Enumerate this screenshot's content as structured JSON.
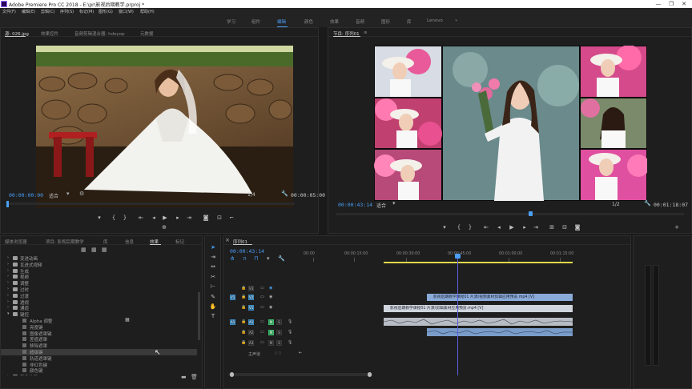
{
  "window": {
    "title": "Adobe Premiere Pro CC 2018 - E:\\pr\\影视后期教学.prproj *",
    "controls": [
      "—",
      "❐",
      "✕"
    ]
  },
  "menu": [
    "文件(F)",
    "编辑(E)",
    "剪辑(C)",
    "序列(S)",
    "标记(M)",
    "图形(G)",
    "窗口(W)",
    "帮助(H)"
  ],
  "workspaces": {
    "items": [
      "学习",
      "组件",
      "编辑",
      "颜色",
      "效果",
      "音频",
      "图形",
      "库",
      "Lenovo"
    ],
    "active_index": 2,
    "more": "»"
  },
  "source_monitor": {
    "tabs": [
      "源: 026.jpg",
      "效果控件",
      "音频剪辑混合器: hdeyop",
      "元数据"
    ],
    "active_index": 0,
    "timecode_in": "00:00:00:00",
    "fit": "适合",
    "fraction": "1/4",
    "duration": "00:00:05:00"
  },
  "program_monitor": {
    "tab": "节目: 序列01",
    "menu_icon": "≡",
    "timecode": "00:00:43:14",
    "fit": "适合",
    "fraction": "1/2",
    "duration": "00:01:18:07"
  },
  "project_panel": {
    "tabs": [
      "媒体浏览器",
      "项目: 影视后期教学",
      "库",
      "信息",
      "效果",
      "标记"
    ],
    "active_index": 4,
    "items": [
      {
        "label": "变进动画",
        "level": 1
      },
      {
        "label": "瓦进式视频",
        "level": 1
      },
      {
        "label": "生成",
        "level": 1
      },
      {
        "label": "视频",
        "level": 1
      },
      {
        "label": "调整",
        "level": 1
      },
      {
        "label": "过时",
        "level": 1
      },
      {
        "label": "过渡",
        "level": 1
      },
      {
        "label": "透视",
        "level": 1
      },
      {
        "label": "通道",
        "level": 1
      },
      {
        "label": "键控",
        "level": 1,
        "expanded": true
      },
      {
        "label": "Alpha 调整",
        "level": 2
      },
      {
        "label": "亮度键",
        "level": 2
      },
      {
        "label": "图像遮罩键",
        "level": 2
      },
      {
        "label": "差值遮罩",
        "level": 2
      },
      {
        "label": "移除遮罩",
        "level": 2
      },
      {
        "label": "超级键",
        "level": 2,
        "selected": true
      },
      {
        "label": "轨道遮罩键",
        "level": 2
      },
      {
        "label": "非红色键",
        "level": 2
      },
      {
        "label": "颜色键",
        "level": 2
      },
      {
        "label": "颜色校正",
        "level": 1
      },
      {
        "label": "风格化",
        "level": 1
      }
    ]
  },
  "timeline": {
    "tab": "序列01",
    "timecode": "00:00:43:14",
    "ruler": [
      "00:00",
      "00:00:15:00",
      "00:00:30:00",
      "00:00:45:00",
      "00:01:00:00",
      "00:01:15:00"
    ],
    "tracks": [
      {
        "name": "V3"
      },
      {
        "name": "V2"
      },
      {
        "name": "V1"
      },
      {
        "name": "A1"
      },
      {
        "name": "A2"
      },
      {
        "name": "A3"
      }
    ],
    "master": {
      "label": "主声道",
      "value": "0.0"
    },
    "clips": {
      "v2": "影视后期教学课程01 片源/视频素材剪辑应用预览.mp4 [V]",
      "v1": "影视后期教学课程01 片源/剪辑素材应用预览.mp4 [V]"
    }
  },
  "colors": {
    "accent": "#4a9ff5",
    "clip_blue": "#8aaad8",
    "clip_light": "#d0d4dc",
    "audio_green": "#2f9c58",
    "playhead": "#5a60e0",
    "work_area": "#e2d94a"
  }
}
